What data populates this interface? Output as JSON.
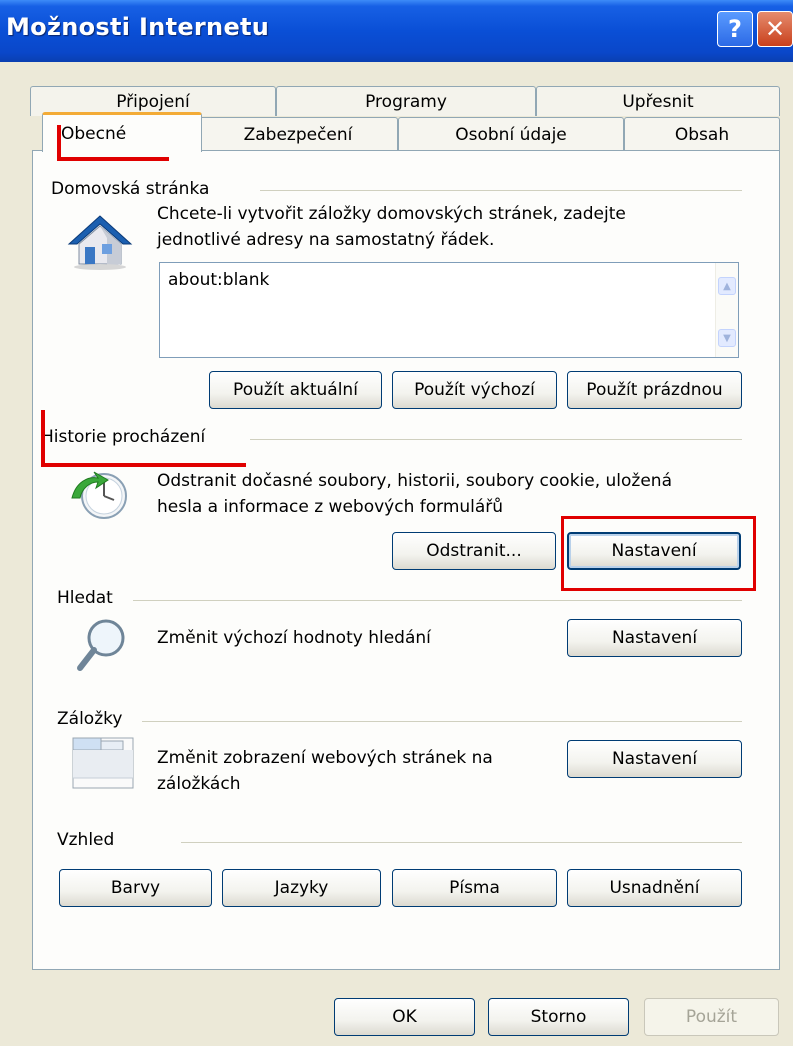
{
  "window": {
    "title": "Možnosti Internetu"
  },
  "tabs": {
    "back": [
      "Připojení",
      "Programy",
      "Upřesnit"
    ],
    "front": [
      "Obecné",
      "Zabezpečení",
      "Osobní údaje",
      "Obsah"
    ],
    "active": "Obecné"
  },
  "home": {
    "label": "Domovská stránka",
    "desc_line1": "Chcete-li vytvořit záložky domovských stránek, zadejte",
    "desc_line2": "jednotlivé adresy na samostatný řádek.",
    "url_value": "about:blank",
    "btn_current": "Použít aktuální",
    "btn_default": "Použít výchozí",
    "btn_blank": "Použít prázdnou"
  },
  "history": {
    "label": "Historie procházení",
    "desc_line1": "Odstranit dočasné soubory, historii, soubory cookie, uložená",
    "desc_line2": "hesla a informace z webových formulářů",
    "btn_delete": "Odstranit...",
    "btn_settings": "Nastavení"
  },
  "search": {
    "label": "Hledat",
    "desc": "Změnit výchozí hodnoty hledání",
    "btn_settings": "Nastavení"
  },
  "tabs_section": {
    "label": "Záložky",
    "desc_line1": "Změnit zobrazení webových stránek na",
    "desc_line2": "záložkách",
    "btn_settings": "Nastavení"
  },
  "appearance": {
    "label": "Vzhled",
    "btn_colors": "Barvy",
    "btn_languages": "Jazyky",
    "btn_fonts": "Písma",
    "btn_accessibility": "Usnadnění"
  },
  "footer": {
    "ok": "OK",
    "cancel": "Storno",
    "apply": "Použít"
  },
  "colors": {
    "titlebar": "#0a4fd6",
    "dialog_bg": "#ece9d8",
    "highlight": "#e00000",
    "active_tab_accent": "#f3ab36"
  }
}
